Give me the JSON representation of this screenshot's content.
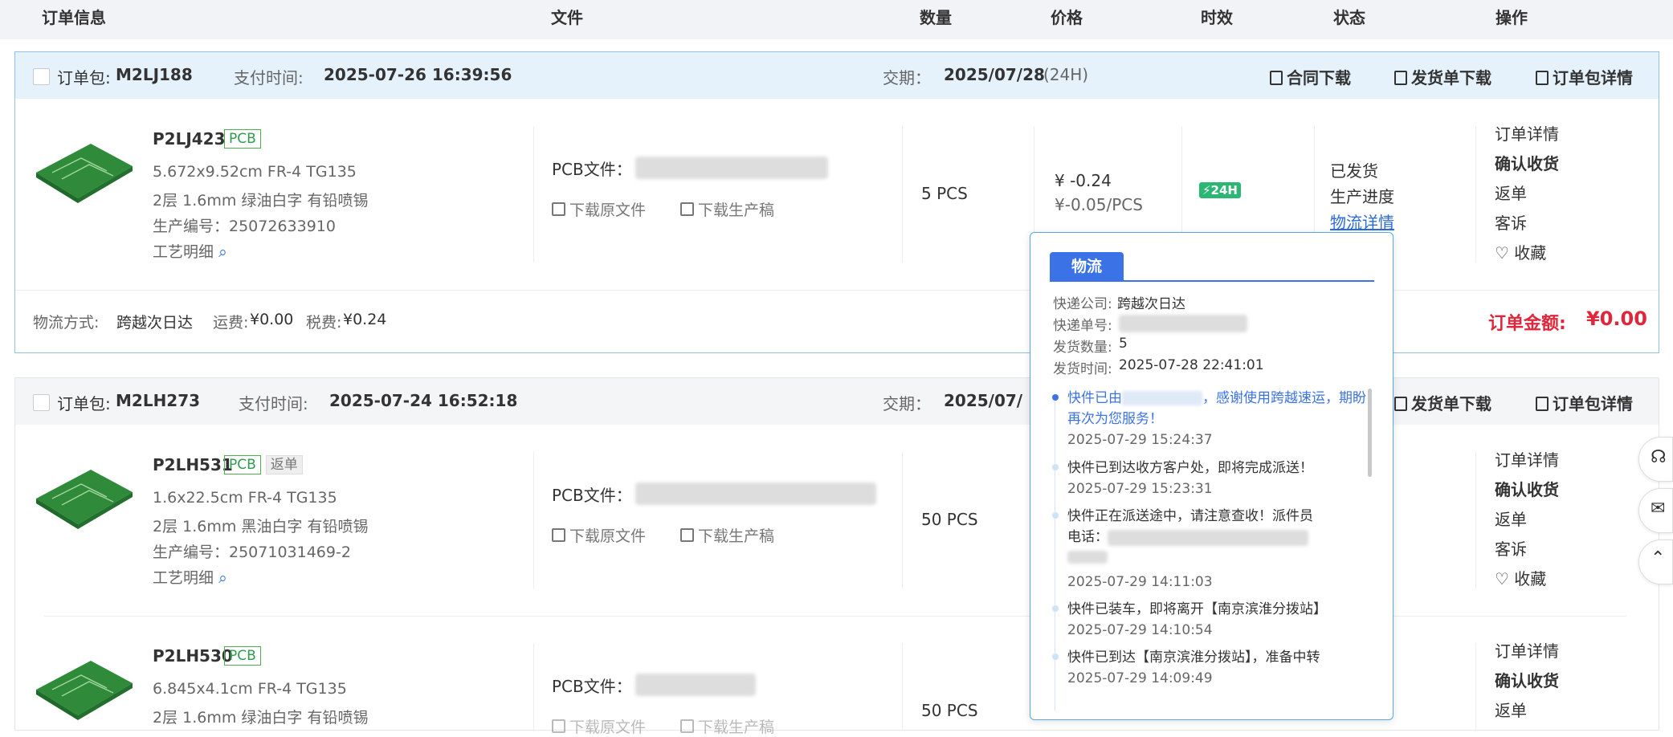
{
  "header": {
    "order_info": "订单信息",
    "file": "文件",
    "quantity": "数量",
    "price": "价格",
    "lead_time": "时效",
    "status": "状态",
    "action": "操作"
  },
  "package1": {
    "pkg_label": "订单包:",
    "pkg_id": "M2LJ188",
    "pay_label": "支付时间:",
    "pay_time": "2025-07-26 16:39:56",
    "delivery_label": "交期：",
    "delivery_date": "2025/07/28",
    "delivery_suffix": "(24H)",
    "contract_download": "合同下载",
    "invoice_download": "发货单下载",
    "pkg_details": "订单包详情",
    "item": {
      "id": "P2LJ423",
      "tag": "PCB",
      "spec1": "5.672x9.52cm FR-4 TG135",
      "spec2": "2层 1.6mm 绿油白字 有铅喷锡",
      "prod_no": "生产编号：25072633910",
      "process": "工艺明细",
      "file_label": "PCB文件：",
      "download_src": "下载原文件",
      "download_prod": "下载生产稿",
      "qty": "5 PCS",
      "price": "¥ -0.24",
      "unit_price": "¥-0.05/PCS",
      "speed": "24H",
      "status1": "已发货",
      "status2": "生产进度",
      "status3": "物流详情",
      "ops": [
        "订单详情",
        "确认收货",
        "返单",
        "客诉",
        "收藏"
      ]
    },
    "shipping_label": "物流方式:",
    "shipping_method": "跨越次日达",
    "freight_label": "运费:",
    "freight": "¥0.00",
    "tax_label": "税费:",
    "tax": "¥0.24",
    "total_label": "订单金额:",
    "total": "¥0.00"
  },
  "package2": {
    "pkg_label": "订单包:",
    "pkg_id": "M2LH273",
    "pay_label": "支付时间:",
    "pay_time": "2025-07-24 16:52:18",
    "delivery_label": "交期：",
    "delivery_date": "2025/07/",
    "invoice_download": "发货单下载",
    "pkg_details": "订单包详情",
    "items": [
      {
        "id": "P2LH531",
        "tag": "PCB",
        "tag2": "返单",
        "spec1": "1.6x22.5cm FR-4 TG135",
        "spec2": "2层 1.6mm 黑油白字 有铅喷锡",
        "prod_no": "生产编号：25071031469-2",
        "process": "工艺明细",
        "file_label": "PCB文件：",
        "download_src": "下载原文件",
        "download_prod": "下载生产稿",
        "qty": "50 PCS",
        "ops": [
          "订单详情",
          "确认收货",
          "返单",
          "客诉",
          "收藏"
        ]
      },
      {
        "id": "P2LH530",
        "tag": "PCB",
        "spec1": "6.845x4.1cm FR-4 TG135",
        "spec2": "2层 1.6mm 绿油白字 有铅喷锡",
        "file_label": "PCB文件：",
        "download_src": "下载原文件",
        "download_prod": "下载生产稿",
        "qty": "50 PCS",
        "ops": [
          "订单详情",
          "确认收货",
          "返单"
        ]
      }
    ]
  },
  "logistics_popup": {
    "tab": "物流",
    "company_label": "快递公司:",
    "company": "跨越次日达",
    "tracking_label": "快递单号:",
    "count_label": "发货数量:",
    "count": "5",
    "time_label": "发货时间:",
    "time": "2025-07-28 22:41:01",
    "events": [
      {
        "text_a": "快件已由",
        "text_b": "，感谢使用跨越速运，期盼再次为您服务！",
        "time": "2025-07-29 15:24:37"
      },
      {
        "text": "快件已到达收方客户处，即将完成派送！",
        "time": "2025-07-29 15:23:31"
      },
      {
        "text": "快件正在派送途中，请注意查收！派件员",
        "text2": "电话：",
        "time": "2025-07-29 14:11:03"
      },
      {
        "text": "快件已装车，即将离开【南京滨淮分拨站】",
        "time": "2025-07-29 14:10:54"
      },
      {
        "text": "快件已到达【南京滨淮分拨站】，准备中转",
        "time": "2025-07-29 14:09:49"
      }
    ]
  },
  "colors": {
    "accent_blue": "#2d6cd9",
    "total_red": "#e0263b",
    "speed_green": "#2bb673",
    "tab_blue": "#3b73e6"
  }
}
